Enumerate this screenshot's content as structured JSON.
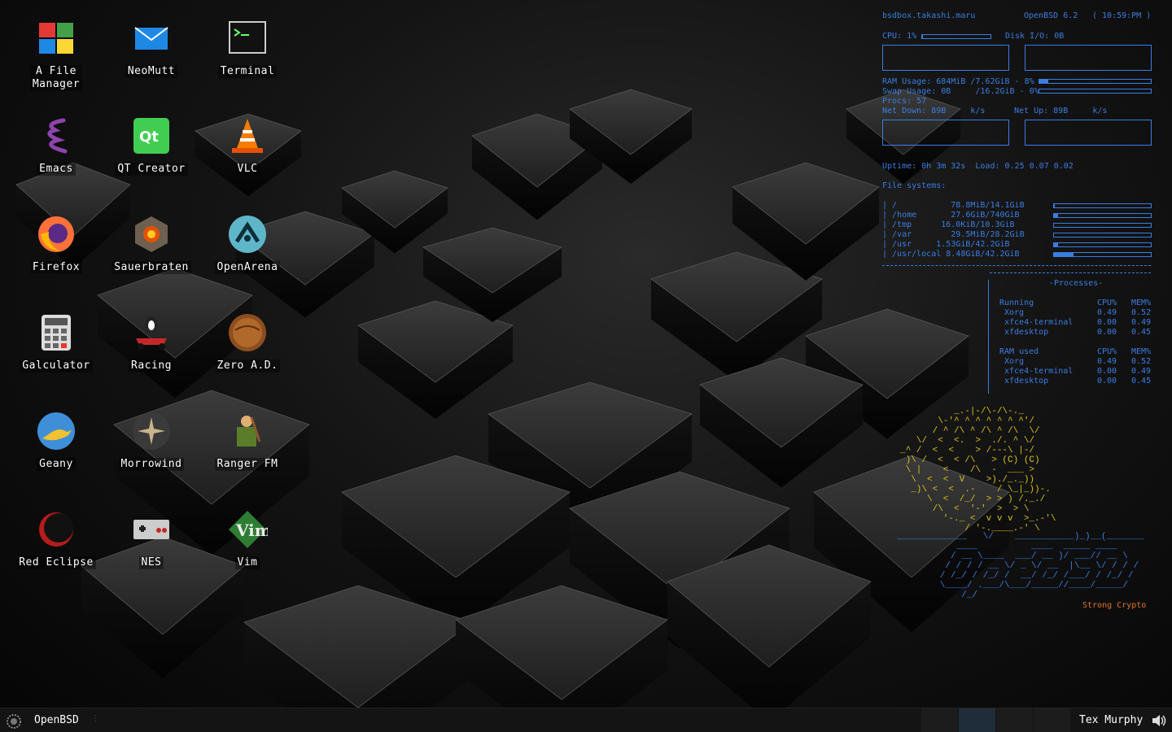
{
  "desktop_icons": [
    {
      "label": "A File\nManager",
      "icon": "file-manager-icon"
    },
    {
      "label": "NeoMutt",
      "icon": "mail-icon"
    },
    {
      "label": "Terminal",
      "icon": "terminal-icon"
    },
    {
      "label": "Emacs",
      "icon": "emacs-icon"
    },
    {
      "label": "QT Creator",
      "icon": "qt-creator-icon"
    },
    {
      "label": "VLC",
      "icon": "vlc-cone-icon"
    },
    {
      "label": "Firefox",
      "icon": "firefox-icon"
    },
    {
      "label": "Sauerbraten",
      "icon": "sauerbraten-icon"
    },
    {
      "label": "OpenArena",
      "icon": "openarena-icon"
    },
    {
      "label": "Galculator",
      "icon": "calculator-icon"
    },
    {
      "label": "Racing",
      "icon": "racing-kart-icon"
    },
    {
      "label": "Zero A.D.",
      "icon": "zero-ad-icon"
    },
    {
      "label": "Geany",
      "icon": "geany-lamp-icon"
    },
    {
      "label": "Morrowind",
      "icon": "morrowind-icon"
    },
    {
      "label": "Ranger FM",
      "icon": "ranger-icon"
    },
    {
      "label": "Red Eclipse",
      "icon": "red-eclipse-icon"
    },
    {
      "label": "NES",
      "icon": "nes-controller-icon"
    },
    {
      "label": "Vim",
      "icon": "vim-icon"
    }
  ],
  "conky": {
    "host": "bsdbox.takashi.maru",
    "os": "OpenBSD 6.2",
    "time": "( 10:59:PM )",
    "cpu": "CPU: 1%",
    "cpu_percent": 1,
    "disk_io": "Disk I/O: 0B",
    "ram": "RAM Usage: 684MiB /7.62GiB - 8%",
    "ram_percent": 8,
    "swap": "Swap Usage: 0B     /16.2GiB - 0%",
    "swap_percent": 0,
    "procs": "Procs: 57",
    "net_down": "Net Down: 89B     k/s",
    "net_up": "Net Up: 89B     k/s",
    "uptime": "Uptime: 0h 3m 32s  Load: 0.25 0.07 0.02",
    "fs_title": "File systems:",
    "filesystems": [
      {
        "line": "/           78.8MiB/14.1GiB",
        "percent": 1
      },
      {
        "line": "/home       27.6GiB/740GiB",
        "percent": 4
      },
      {
        "line": "/tmp      16.0KiB/10.3GiB",
        "percent": 0
      },
      {
        "line": "/var        29.5MiB/28.2GiB",
        "percent": 0
      },
      {
        "line": "/usr     1.53GiB/42.2GiB",
        "percent": 4
      },
      {
        "line": "/usr/local 8.48GiB/42.2GiB",
        "percent": 20
      }
    ],
    "processes_title": "-Processes-",
    "running_header": "Running",
    "ram_header": "RAM used",
    "col_cpu": "CPU%",
    "col_mem": "MEM%",
    "running": [
      {
        "name": "Xorg",
        "cpu": "0.49",
        "mem": "0.52"
      },
      {
        "name": "xfce4-terminal",
        "cpu": "0.00",
        "mem": "0.49"
      },
      {
        "name": "xfdesktop",
        "cpu": "0.00",
        "mem": "0.45"
      }
    ],
    "ram_used": [
      {
        "name": "Xorg",
        "cpu": "0.49",
        "mem": "0.52"
      },
      {
        "name": "xfce4-terminal",
        "cpu": "0.00",
        "mem": "0.49"
      },
      {
        "name": "xfdesktop",
        "cpu": "0.00",
        "mem": "0.45"
      }
    ],
    "tagline": "Strong Crypto",
    "accent": "#3b7de0",
    "fish_color": "#d8c21a",
    "tagline_color": "#e0742a"
  },
  "taskbar": {
    "menu_label": "OpenBSD",
    "window_title": "Tex Murphy",
    "menu_icon": "openbsd-puffy-icon",
    "volume_icon": "volume-icon"
  }
}
